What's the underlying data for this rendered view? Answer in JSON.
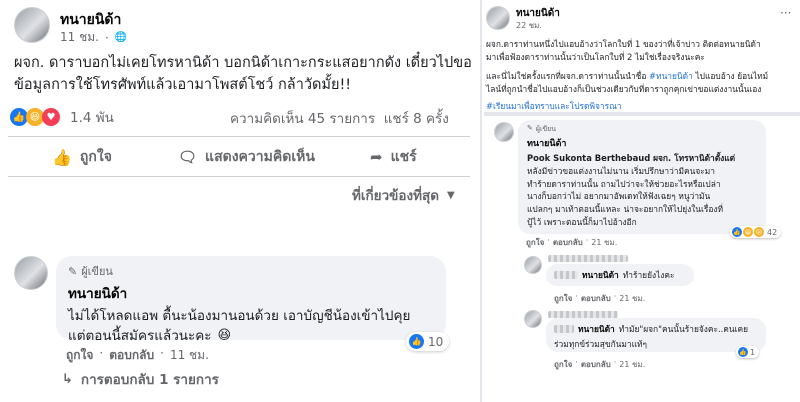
{
  "left": {
    "post": {
      "author": "ทนายนิด้า",
      "time": "11 ชม.",
      "globe": "🌐",
      "text_line1": "ผจก. ดาราบอกไม่เคยโทรหานิด้า บอกนิด้าเกาะกระแสอยากดัง เดี๋ยวไปขอ",
      "text_line2": "ข้อมูลการใช้โทรศัพท์แล้วเอามาโพสต์โชว์ กล้าวัดมั้ย!!",
      "reaction_count": "1.4 พัน",
      "comments_shares": "ความคิดเห็น 45 รายการ  แชร์ 8 ครั้ง",
      "like_label": "ถูกใจ",
      "comment_label": "แสดงความคิดเห็น",
      "share_label": "แชร์",
      "sort_label": "ที่เกี่ยวข้องที่สุด"
    },
    "comment": {
      "badge": "ผู้เขียน",
      "author": "ทนายนิด้า",
      "text_line1": "ไม่ได้โหลดแอพ ตื้นะน้องมานอนด้วย เอาบัญชีน้องเข้าไปคุย",
      "text_line2": "แต่ตอนนี้สมัครแล้วนะคะ",
      "like_label": "ถูกใจ",
      "reply_label": "ตอบกลับ",
      "time": "11 ชม.",
      "reaction_count": "10",
      "replies_label": "การตอบกลับ 1 รายการ"
    }
  },
  "right": {
    "post": {
      "author": "ทนายนิด้า",
      "time": "22 ชม.",
      "text_line1": "ผจก.ดาราท่านหนึ่งไปแอบอ้างว่าโลกใบที่ 1 ของว่าที่เจ้าบ่าว ติดต่อทนายนิด้า",
      "text_line2": "มาเพื่อฟ้องดาราท่านนั้นว่าเป็นโลกใบที่ 2 ไม่ใช่เรื่องจริงนะคะ",
      "text_line3a": "และนี่ไม่ใช่ครั้งแรกที่ผจก.ดาราท่านนั้นนำชื่อ ",
      "hashtag": "#ทนายนิด้า",
      "text_line3b": " ไปแอบอ้าง ย้อนไทม์",
      "text_line4": "ไลน์ที่ถูกนำชื่อไปแอบอ้างก็เป็นช่วงเดียวกับที่ดาราถูกคุกเข่าขอแต่งงานนั้นเอง",
      "hashtag2": "#เรียนมาเพื่อทราบและโปรดพิจารณา"
    },
    "comment1": {
      "badge": "ผู้เขียน",
      "author": "ทนายนิด้า",
      "line1": "Pook Sukonta Berthebaud ผจก. โทรหานิด้าตั้งแต่",
      "line2": "หลังมีข่าวขอแต่งงานไม่นาน เริ่มปรึกษาว่ามีคนจะมา",
      "line3": "ทำร้ายดาราท่านนั้น ถามไปว่าจะให้ช่วยอะไรหรือเปล่า",
      "line4": "นางก็บอกว่าไม่ อยากมาอัพเดทให้ฟังเฉยๆ หนูว่ามัน",
      "line5": "แปลกๆ มาเท้าตอนนี้แหละ น่าจะอยากให้ไปยุ่งในเรื่องที่",
      "line6": "ปู้ไว้ เพราะตอนนี้ก็มาไปอ้างอีก",
      "like_label": "ถูกใจ",
      "reply_label": "ตอบกลับ",
      "time": "21 ชม.",
      "reaction_count": "42"
    },
    "comment2": {
      "author": "ทนายนิด้า",
      "text": "ทำร้ายยังไงคะ",
      "like_label": "ถูกใจ",
      "reply_label": "ตอบกลับ",
      "time": "21 ชม."
    },
    "comment3": {
      "author": "ทนายนิด้า",
      "line1": "ทำมัย\"ผจก\"คนนั้นร้ายจังคะ..คนเคย",
      "line2": "ร่วมทุกข์ร่วมสุขกันมาแท้ๆ",
      "like_label": "ถูกใจ",
      "reply_label": "ตอบกลับ",
      "time": "21 ชม.",
      "reaction_count": "1"
    }
  }
}
